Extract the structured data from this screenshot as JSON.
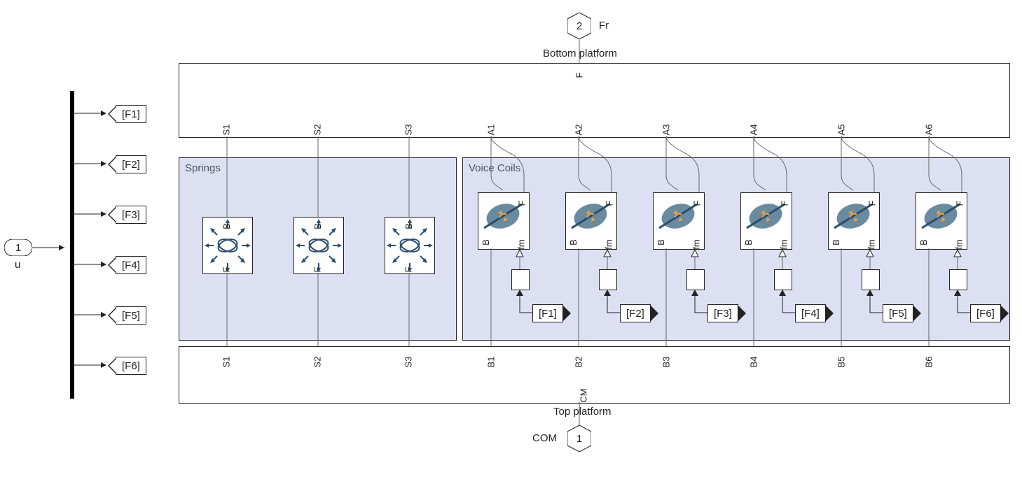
{
  "input": {
    "num": "1",
    "name": "u"
  },
  "gotos": [
    "[F1]",
    "[F2]",
    "[F3]",
    "[F4]",
    "[F5]",
    "[F6]"
  ],
  "topHex": {
    "num": "2",
    "name": "Fr"
  },
  "topBox": {
    "title": "Bottom platform",
    "portF": "F",
    "springs": [
      "S1",
      "S2",
      "S3"
    ],
    "vc": [
      "A1",
      "A2",
      "A3",
      "A4",
      "A5",
      "A6"
    ]
  },
  "areas": {
    "springs": "Springs",
    "vc": "Voice Coils"
  },
  "springPorts": {
    "top": "B",
    "bottom": "F"
  },
  "vcPorts": {
    "left": "B",
    "right": "F",
    "bottom": "fm"
  },
  "froms": [
    "[F1]",
    "[F2]",
    "[F3]",
    "[F4]",
    "[F5]",
    "[F6]"
  ],
  "botBox": {
    "title": "Top platform",
    "portCM": "CM",
    "springs": [
      "S1",
      "S2",
      "S3"
    ],
    "vc": [
      "B1",
      "B2",
      "B3",
      "B4",
      "B5",
      "B6"
    ]
  },
  "botHex": {
    "num": "1",
    "name": "COM"
  }
}
